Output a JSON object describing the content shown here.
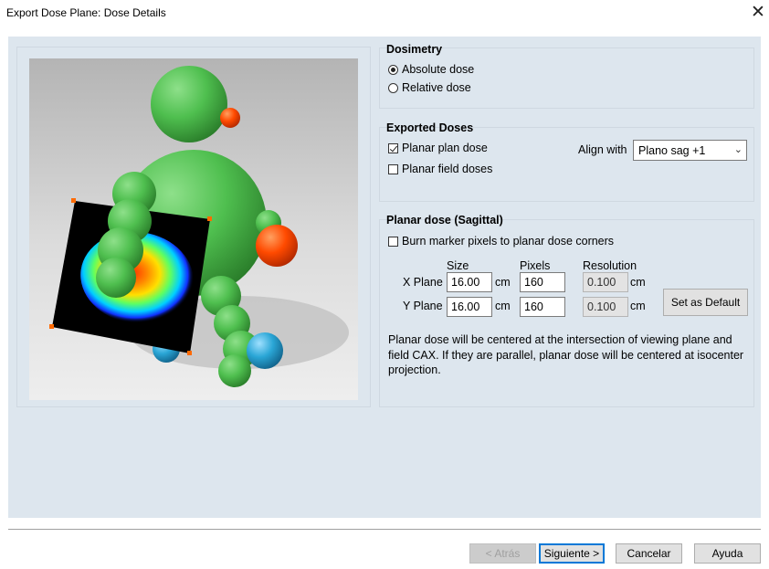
{
  "window": {
    "title": "Export Dose Plane: Dose Details",
    "close_glyph": "✕"
  },
  "dosimetry": {
    "title": "Dosimetry",
    "options": [
      {
        "label": "Absolute dose",
        "selected": true
      },
      {
        "label": "Relative dose",
        "selected": false
      }
    ]
  },
  "exported_doses": {
    "title": "Exported Doses",
    "planar_plan_dose": {
      "label": "Planar plan dose",
      "checked": true
    },
    "planar_field_doses": {
      "label": "Planar field doses",
      "checked": false
    },
    "align_with_label": "Align with",
    "align_with_value": "Plano sag +1"
  },
  "planar_dose": {
    "title": "Planar dose (Sagittal)",
    "burn_marker": {
      "label": "Burn marker pixels to planar dose corners",
      "checked": false
    },
    "headers": {
      "size": "Size",
      "pixels": "Pixels",
      "resolution": "Resolution"
    },
    "rows": [
      {
        "label": "X Plane",
        "size": "16.00",
        "size_unit": "cm",
        "pixels": "160",
        "resolution": "0.100",
        "resolution_unit": "cm"
      },
      {
        "label": "Y Plane",
        "size": "16.00",
        "size_unit": "cm",
        "pixels": "160",
        "resolution": "0.100",
        "resolution_unit": "cm"
      }
    ],
    "set_default_label": "Set as Default",
    "note": "Planar dose will be centered at the intersection of viewing plane and field CAX. If they are parallel, planar dose will be centered at isocenter projection."
  },
  "footer": {
    "back_label": "< Atrás",
    "next_label": "Siguiente >",
    "cancel_label": "Cancelar",
    "help_label": "Ayuda"
  },
  "colors": {
    "panel_background": "#dde6ee",
    "figure_green": "#4fbf4f",
    "nose_orange": "#ff4a00",
    "ball_blue": "#2aa6d6"
  }
}
